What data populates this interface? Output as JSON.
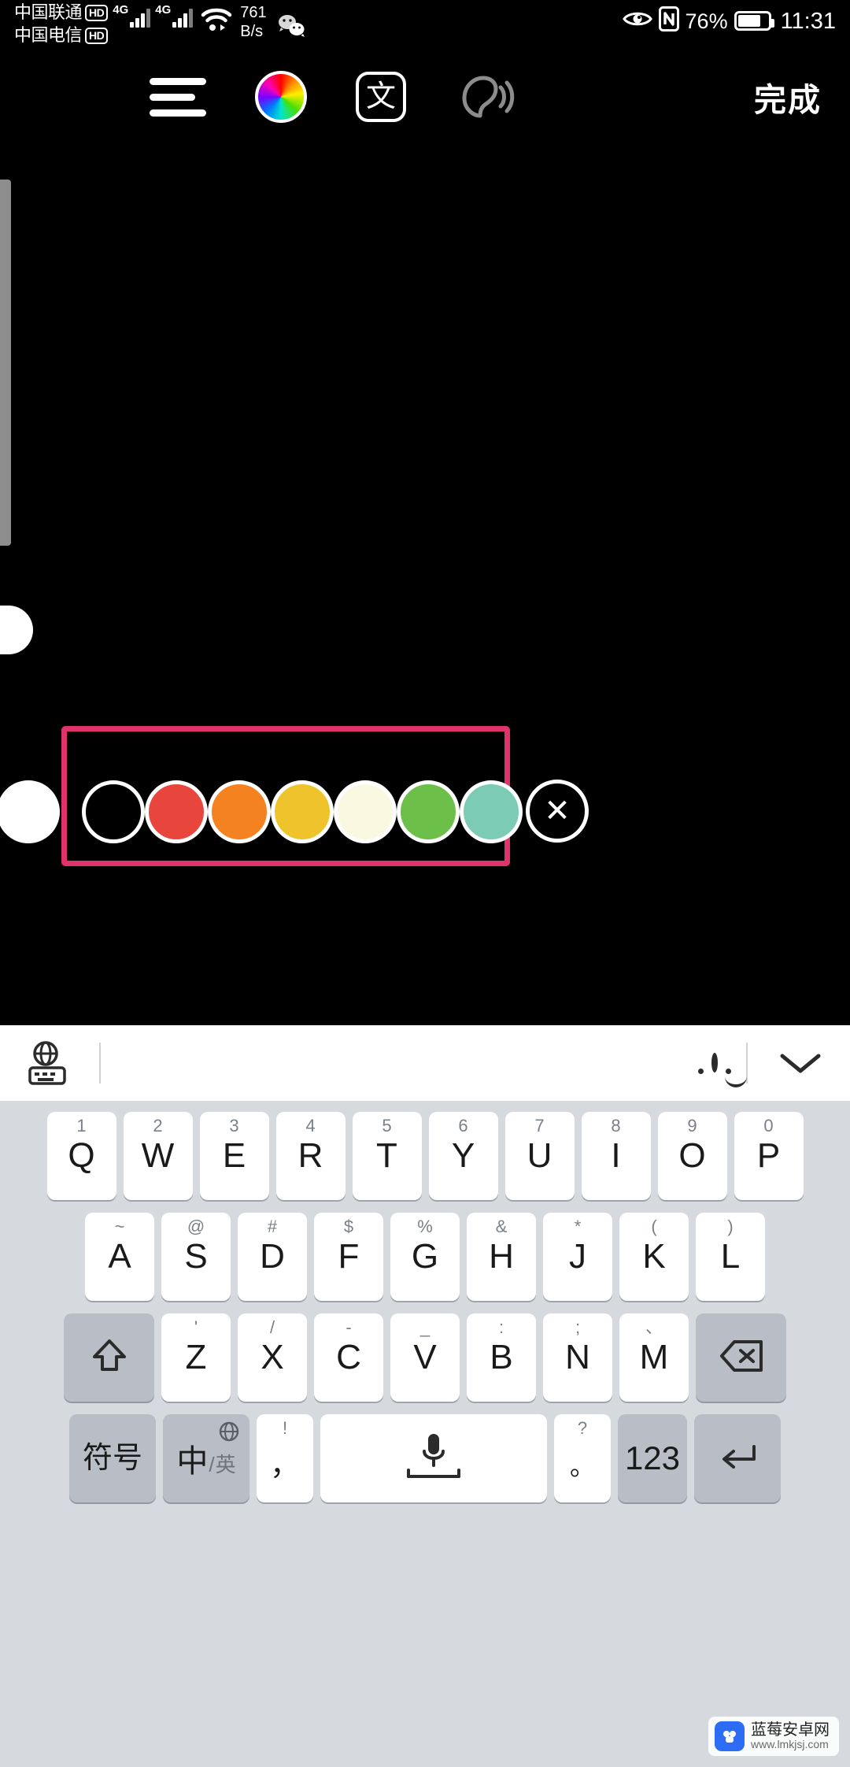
{
  "status_bar": {
    "carrier_1": "中国联通",
    "carrier_1_badge": "HD",
    "carrier_2": "中国电信",
    "carrier_2_badge": "HD",
    "network_1": "4G",
    "network_2": "4G",
    "data_speed_value": "761",
    "data_speed_unit": "B/s",
    "wechat_icon": "wechat-icon",
    "eye_icon": "eye-care-icon",
    "nfc_icon": "nfc-icon",
    "battery_percent": "76%",
    "clock": "11:31"
  },
  "toolbar": {
    "align_icon": "text-align-icon",
    "color_wheel_icon": "color-wheel-icon",
    "translate_label": "文",
    "tts_icon": "text-to-speech-icon",
    "done_label": "完成"
  },
  "color_picker": {
    "swatches": [
      {
        "name": "white",
        "color": "#FFFFFF"
      },
      {
        "name": "black",
        "color": "#000000"
      },
      {
        "name": "red",
        "color": "#E8453C"
      },
      {
        "name": "orange",
        "color": "#F58220"
      },
      {
        "name": "yellow",
        "color": "#EFC32C"
      },
      {
        "name": "cream",
        "color": "#FAF8E0"
      },
      {
        "name": "green",
        "color": "#6CC04A"
      },
      {
        "name": "mint",
        "color": "#7CCCB5"
      }
    ],
    "close_label": "✕",
    "highlight_color": "#E0336C"
  },
  "keyboard_bar": {
    "globe_icon": "input-method-switch-icon",
    "emoji_icon": "emoji-icon",
    "collapse_icon": "chevron-down-icon"
  },
  "keyboard": {
    "row1": [
      {
        "sup": "1",
        "main": "Q"
      },
      {
        "sup": "2",
        "main": "W"
      },
      {
        "sup": "3",
        "main": "E"
      },
      {
        "sup": "4",
        "main": "R"
      },
      {
        "sup": "5",
        "main": "T"
      },
      {
        "sup": "6",
        "main": "Y"
      },
      {
        "sup": "7",
        "main": "U"
      },
      {
        "sup": "8",
        "main": "I"
      },
      {
        "sup": "9",
        "main": "O"
      },
      {
        "sup": "0",
        "main": "P"
      }
    ],
    "row2": [
      {
        "sup": "~",
        "main": "A"
      },
      {
        "sup": "@",
        "main": "S"
      },
      {
        "sup": "#",
        "main": "D"
      },
      {
        "sup": "$",
        "main": "F"
      },
      {
        "sup": "%",
        "main": "G"
      },
      {
        "sup": "&",
        "main": "H"
      },
      {
        "sup": "*",
        "main": "J"
      },
      {
        "sup": "(",
        "main": "K"
      },
      {
        "sup": ")",
        "main": "L"
      }
    ],
    "row3": [
      {
        "sup": "'",
        "main": "Z"
      },
      {
        "sup": "/",
        "main": "X"
      },
      {
        "sup": "-",
        "main": "C"
      },
      {
        "sup": "_",
        "main": "V"
      },
      {
        "sup": ":",
        "main": "B"
      },
      {
        "sup": ";",
        "main": "N"
      },
      {
        "sup": "、",
        "main": "M"
      }
    ],
    "shift_icon": "shift-icon",
    "backspace_icon": "backspace-icon",
    "symbols_label": "符号",
    "lang_zh": "中",
    "lang_sep": "/",
    "lang_en": "英",
    "comma_sup": "!",
    "comma_main": "，",
    "space_icon": "microphone-icon",
    "period_sup": "?",
    "period_main": "。",
    "num_label": "123",
    "enter_icon": "enter-icon"
  },
  "watermark": {
    "line1": "蓝莓安卓网",
    "line2": "www.lmkjsj.com"
  }
}
